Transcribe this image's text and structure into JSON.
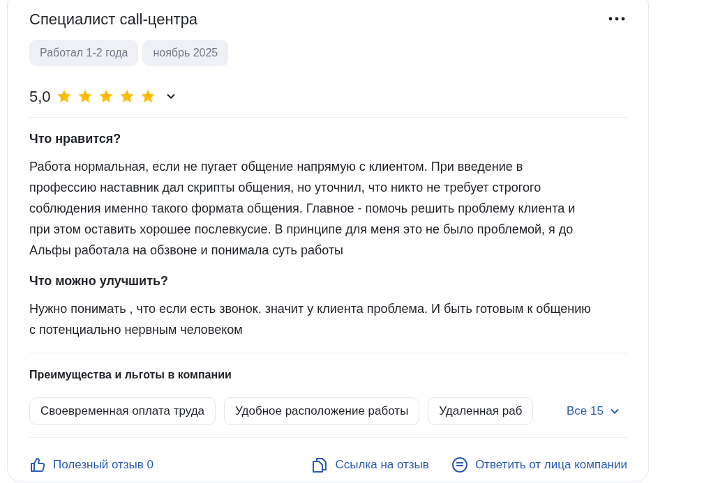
{
  "review": {
    "title": "Специалист call-центра",
    "tags": [
      "Работал 1-2 года",
      "ноябрь 2025"
    ],
    "rating": {
      "value": "5,0",
      "stars": 5
    },
    "sections": [
      {
        "heading": "Что нравится?",
        "text": "Работа нормальная, если не пугает общение напрямую с клиентом. При введение в профессию наставник дал скрипты общения, но уточнил, что никто не требует строгого соблюдения именно такого формата общения. Главное - помочь решить проблему клиента и при этом оставить хорошее послевкусие. В принципе для меня это не было проблемой, я до Альфы работала на обзвоне и понимала суть работы"
      },
      {
        "heading": "Что можно улучшить?",
        "text": "Нужно понимать , что если есть звонок. значит у клиента проблема. И быть готовым к общению с потенциально нервным человеком"
      }
    ],
    "benefits": {
      "heading": "Преимущества и льготы в компании",
      "items": [
        "Своевременная оплата труда",
        "Удобное расположение работы",
        "Удаленная раб"
      ],
      "show_all": "Все 15"
    },
    "actions": [
      {
        "kind": "like",
        "label": "Полезный отзыв 0"
      },
      {
        "kind": "link",
        "label": "Ссылка на отзыв"
      },
      {
        "kind": "reply",
        "label": "Ответить от лица компании"
      }
    ]
  }
}
